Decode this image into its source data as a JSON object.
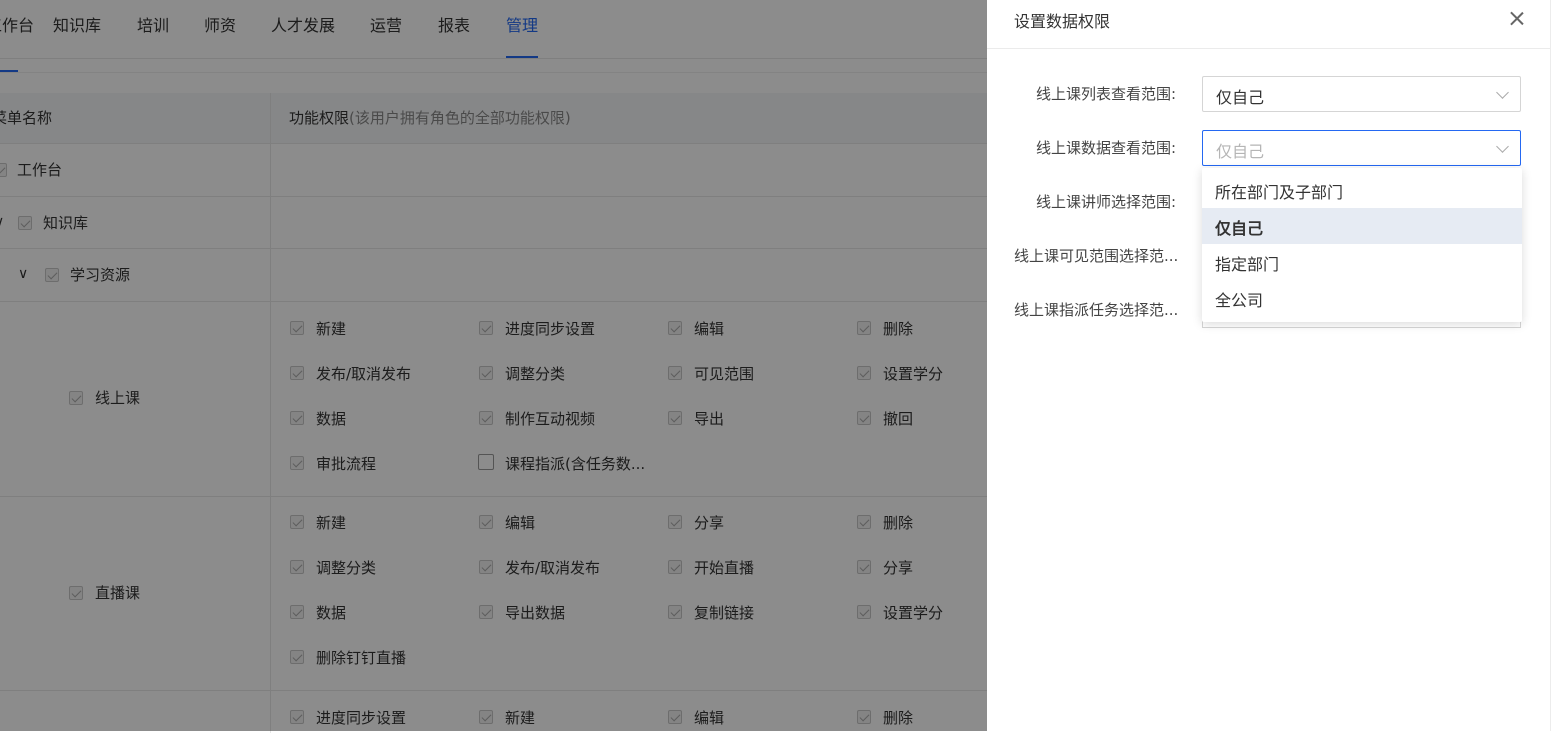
{
  "nav": {
    "items": [
      "工作台",
      "知识库",
      "培训",
      "师资",
      "人才发展",
      "运营",
      "报表",
      "管理"
    ],
    "active_index": 7
  },
  "table": {
    "header_menu": "菜单名称",
    "header_perm": "功能权限",
    "header_perm_note": "(该用户拥有角色的全部功能权限)",
    "tree": {
      "workbench": "工作台",
      "knowledge": "知识库",
      "resources": "学习资源"
    },
    "online_course": {
      "label": "线上课",
      "perms": [
        "新建",
        "进度同步设置",
        "编辑",
        "删除",
        "发布/取消发布",
        "调整分类",
        "可见范围",
        "设置学分",
        "数据",
        "制作互动视频",
        "导出",
        "撤回",
        "审批流程",
        "课程指派(含任务数..."
      ]
    },
    "live_course": {
      "label": "直播课",
      "perms": [
        "新建",
        "编辑",
        "分享",
        "删除",
        "调整分类",
        "发布/取消发布",
        "开始直播",
        "分享",
        "数据",
        "导出数据",
        "复制链接",
        "设置学分",
        "删除钉钉直播"
      ]
    },
    "next_row": {
      "perms": [
        "进度同步设置",
        "新建",
        "编辑",
        "删除"
      ]
    }
  },
  "drawer": {
    "title": "设置数据权限",
    "fields": [
      {
        "label": "线上课列表查看范围:",
        "value": "仅自己"
      },
      {
        "label": "线上课数据查看范围:",
        "placeholder": "仅自己"
      },
      {
        "label": "线上课讲师选择范围:"
      },
      {
        "label": "线上课可见范围选择范..."
      },
      {
        "label": "线上课指派任务选择范..."
      }
    ],
    "dropdown_options": [
      "所在部门及子部门",
      "仅自己",
      "指定部门",
      "全公司"
    ],
    "dropdown_selected_index": 1
  },
  "colors": {
    "accent": "#2468f2",
    "overlay": "rgba(0,0,0,0.45)"
  }
}
